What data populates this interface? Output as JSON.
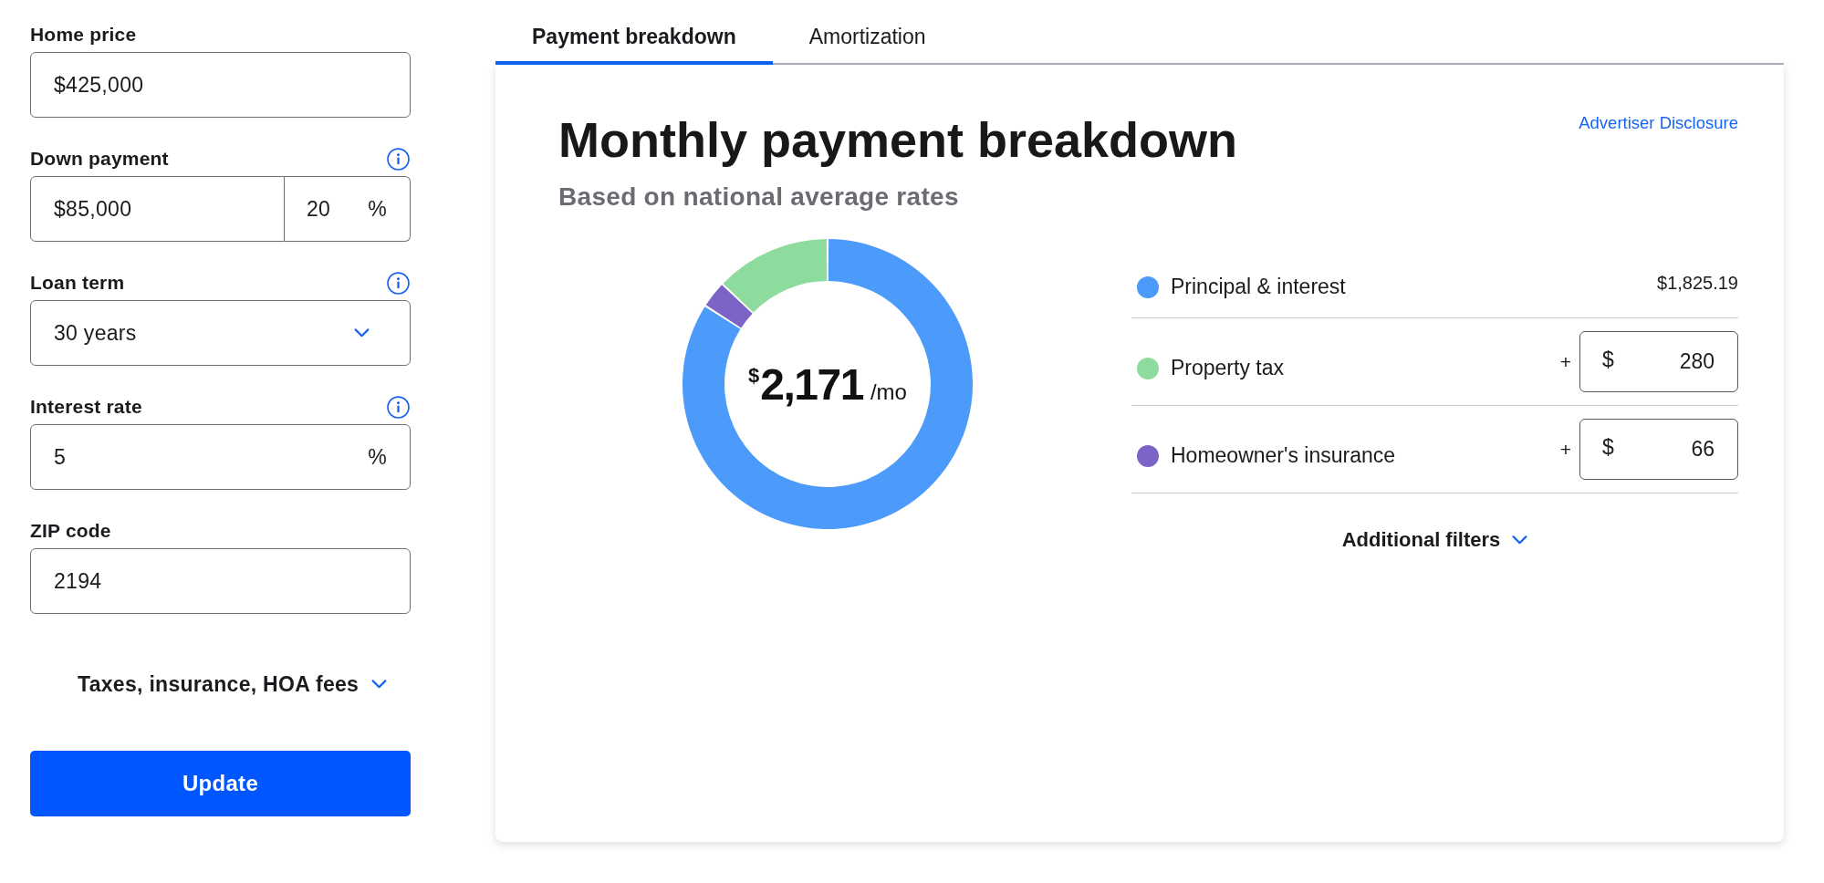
{
  "form": {
    "fields": [
      {
        "kind": "text",
        "label": "Home price",
        "value": "$425,000",
        "info": false
      },
      {
        "kind": "split",
        "label": "Down payment",
        "value": "$85,000",
        "percent_value": "20",
        "suffix": "%",
        "info": true
      },
      {
        "kind": "select",
        "label": "Loan term",
        "value": "30 years",
        "info": true
      },
      {
        "kind": "suffix",
        "label": "Interest rate",
        "value": "5",
        "suffix": "%",
        "info": true
      },
      {
        "kind": "text",
        "label": "ZIP code",
        "value": "2194",
        "info": false
      }
    ],
    "expander": {
      "label": "Taxes, insurance, HOA fees",
      "expanded": false
    },
    "submit": "Update"
  },
  "tabs": [
    {
      "label": "Payment breakdown",
      "selected": true
    },
    {
      "label": "Amortization",
      "selected": false
    }
  ],
  "card": {
    "title": "Monthly payment breakdown",
    "subtitle": "Based on national average rates",
    "disclosure": "Advertiser Disclosure",
    "total": {
      "currency": "$",
      "amount": "2,171",
      "unit": "/mo"
    },
    "chart_data": {
      "type": "donut",
      "values": [
        84.06,
        12.9,
        3.04
      ]
    },
    "items": [
      {
        "kind": "amount",
        "label": "Principal & interest",
        "color": "#4c9bfb",
        "amount": "$1,825.19"
      },
      {
        "kind": "input",
        "label": "Property tax",
        "color": "#8edc9d",
        "sign": "+",
        "currency": "$",
        "value": "280"
      },
      {
        "kind": "input",
        "label": "Homeowner's insurance",
        "color": "#7b64c6",
        "sign": "+",
        "currency": "$",
        "value": "66"
      }
    ],
    "filters": {
      "label": "Additional filters",
      "expanded": false
    }
  }
}
